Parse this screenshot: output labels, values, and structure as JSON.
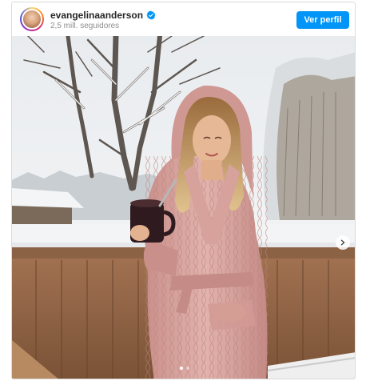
{
  "post": {
    "username": "evangelinaanderson",
    "followers": "2,5 mill. seguidores",
    "profile_button": "Ver perfil",
    "verified_icon": "verified-badge-icon",
    "avatar_icon": "profile-avatar",
    "next_icon": "chevron-right-icon",
    "carousel": {
      "total": 2,
      "active": 1
    }
  },
  "colors": {
    "accent": "#0095f6",
    "username": "#262626",
    "secondary_text": "#8e8e8e",
    "robe": "#d9a6a0"
  }
}
